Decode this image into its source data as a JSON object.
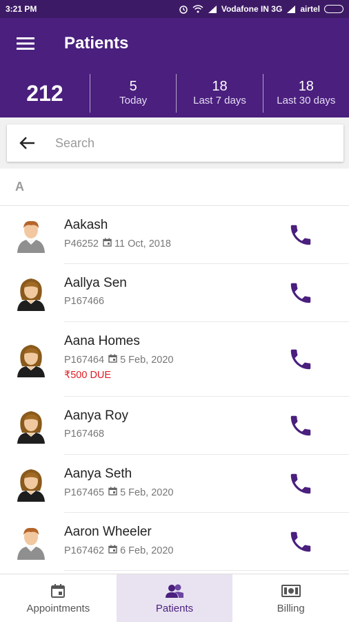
{
  "status": {
    "time": "3:21 PM",
    "carrier1": "Vodafone IN 3G",
    "carrier2": "airtel"
  },
  "appbar": {
    "title": "Patients"
  },
  "stats": {
    "total": "212",
    "today": {
      "value": "5",
      "label": "Today"
    },
    "last7": {
      "value": "18",
      "label": "Last 7 days"
    },
    "last30": {
      "value": "18",
      "label": "Last 30 days"
    }
  },
  "search": {
    "placeholder": "Search"
  },
  "section": "A",
  "patients": [
    {
      "name": "Aakash",
      "id": "P46252",
      "date": "11 Oct, 2018",
      "due": "",
      "gender": "male"
    },
    {
      "name": "Aallya Sen",
      "id": "P167466",
      "date": "",
      "due": "",
      "gender": "female"
    },
    {
      "name": "Aana Homes",
      "id": "P167464",
      "date": "5 Feb, 2020",
      "due": "₹500 DUE",
      "gender": "female"
    },
    {
      "name": "Aanya Roy",
      "id": "P167468",
      "date": "",
      "due": "",
      "gender": "female"
    },
    {
      "name": "Aanya Seth",
      "id": "P167465",
      "date": "5 Feb, 2020",
      "due": "",
      "gender": "female"
    },
    {
      "name": "Aaron Wheeler",
      "id": "P167462",
      "date": "6 Feb, 2020",
      "due": "",
      "gender": "male"
    }
  ],
  "nav": {
    "appointments": "Appointments",
    "patients": "Patients",
    "billing": "Billing"
  },
  "colors": {
    "primary": "#4a1f7e",
    "status_bar": "#3d1a66",
    "due": "#e01b24",
    "active_tab_bg": "#e9e3f1"
  }
}
